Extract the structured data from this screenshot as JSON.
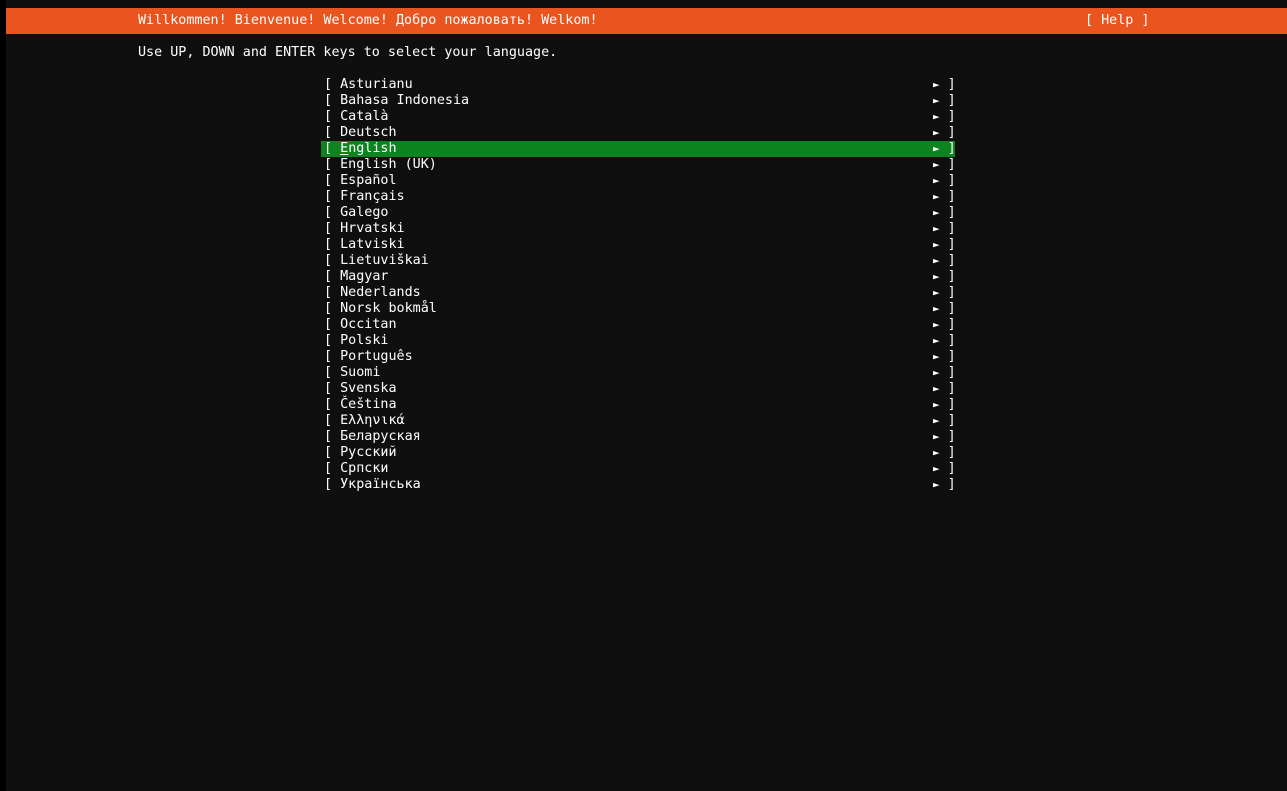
{
  "colors": {
    "orange": "#e9541f",
    "green": "#0e8420",
    "screen_bg": "#0f0f0f",
    "text": "#ffffff"
  },
  "header": {
    "title": "Willkommen! Bienvenue! Welcome! Добро пожаловать! Welkom!",
    "help_label": "[ Help ]"
  },
  "instruction": "Use UP, DOWN and ENTER keys to select your language.",
  "language_list": {
    "selected_index": 4,
    "open_bracket": "[",
    "arrow_icon": "►",
    "close_bracket": "]",
    "items": [
      "Asturianu",
      "Bahasa Indonesia",
      "Català",
      "Deutsch",
      "English",
      "English (UK)",
      "Español",
      "Français",
      "Galego",
      "Hrvatski",
      "Latviski",
      "Lietuviškai",
      "Magyar",
      "Nederlands",
      "Norsk bokmål",
      "Occitan",
      "Polski",
      "Português",
      "Suomi",
      "Svenska",
      "Čeština",
      "Ελληνικά",
      "Беларуская",
      "Русский",
      "Српски",
      "Українська"
    ]
  }
}
